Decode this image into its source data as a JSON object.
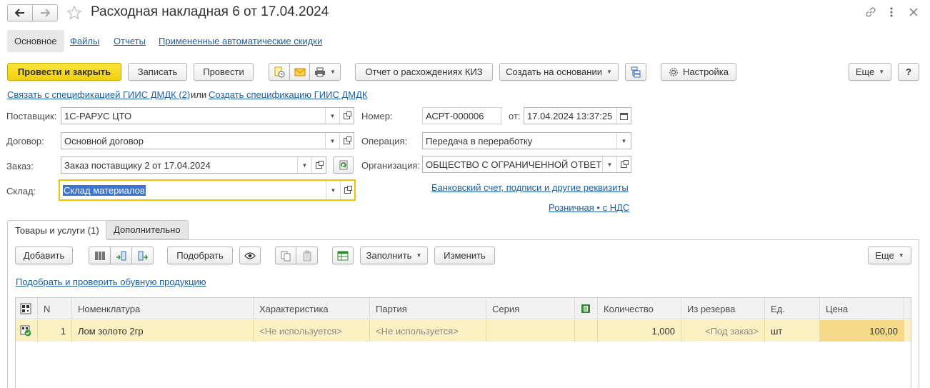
{
  "window": {
    "title": "Расходная накладная 6 от 17.04.2024"
  },
  "section_tabs": [
    {
      "label": "Основное",
      "active": true
    },
    {
      "label": "Файлы"
    },
    {
      "label": "Отчеты"
    },
    {
      "label": "Примененные автоматические скидки"
    }
  ],
  "toolbar": {
    "post_close": "Провести и закрыть",
    "save": "Записать",
    "post": "Провести",
    "kiz_report": "Отчет о расхождениях КИЗ",
    "create_based": "Создать на основании",
    "settings": "Настройка",
    "more": "Еще",
    "help": "?"
  },
  "gis": {
    "link1": "Связать с спецификацией ГИИС ДМДК (2)",
    "or": "или",
    "link2": "Создать спецификацию ГИИС ДМДК"
  },
  "form": {
    "supplier_label": "Поставщик:",
    "supplier_value": "1С-РАРУС ЦТО",
    "contract_label": "Договор:",
    "contract_value": "Основной договор",
    "order_label": "Заказ:",
    "order_value": "Заказ поставщику 2 от 17.04.2024",
    "warehouse_label": "Склад:",
    "warehouse_value": "Склад материалов",
    "number_label": "Номер:",
    "number_value": "АСРТ-000006",
    "date_label": "от:",
    "date_value": "17.04.2024 13:37:25",
    "operation_label": "Операция:",
    "operation_value": "Передача в переработку",
    "org_label": "Организация:",
    "org_value": "ОБЩЕСТВО С ОГРАНИЧЕННОЙ ОТВЕТ",
    "bank_link": "Банковский счет, подписи и другие реквизиты",
    "price_link": "Розничная • с НДС"
  },
  "content_tabs": [
    {
      "label": "Товары и услуги (1)",
      "active": true
    },
    {
      "label": "Дополнительно"
    }
  ],
  "table_toolbar": {
    "add": "Добавить",
    "pick": "Подобрать",
    "fill": "Заполнить",
    "change": "Изменить",
    "more": "Еще",
    "shoe_link": "Подобрать и проверить обувную продукцию"
  },
  "table": {
    "columns": [
      "N",
      "Номенклатура",
      "Характеристика",
      "Партия",
      "Серия",
      "Количество",
      "Из резерва",
      "Ед.",
      "Цена"
    ],
    "rows": [
      {
        "n": "1",
        "item": "Лом золото 2гр",
        "characteristic": "<Не используется>",
        "batch": "<Не используется>",
        "series": "",
        "qty": "1,000",
        "reserve": "<Под заказ>",
        "unit": "шт",
        "price": "100,00"
      }
    ]
  },
  "colors": {
    "accent_yellow": "#f5d313",
    "link_blue": "#1c5ea4",
    "row_highlight": "#fbf1c3"
  }
}
